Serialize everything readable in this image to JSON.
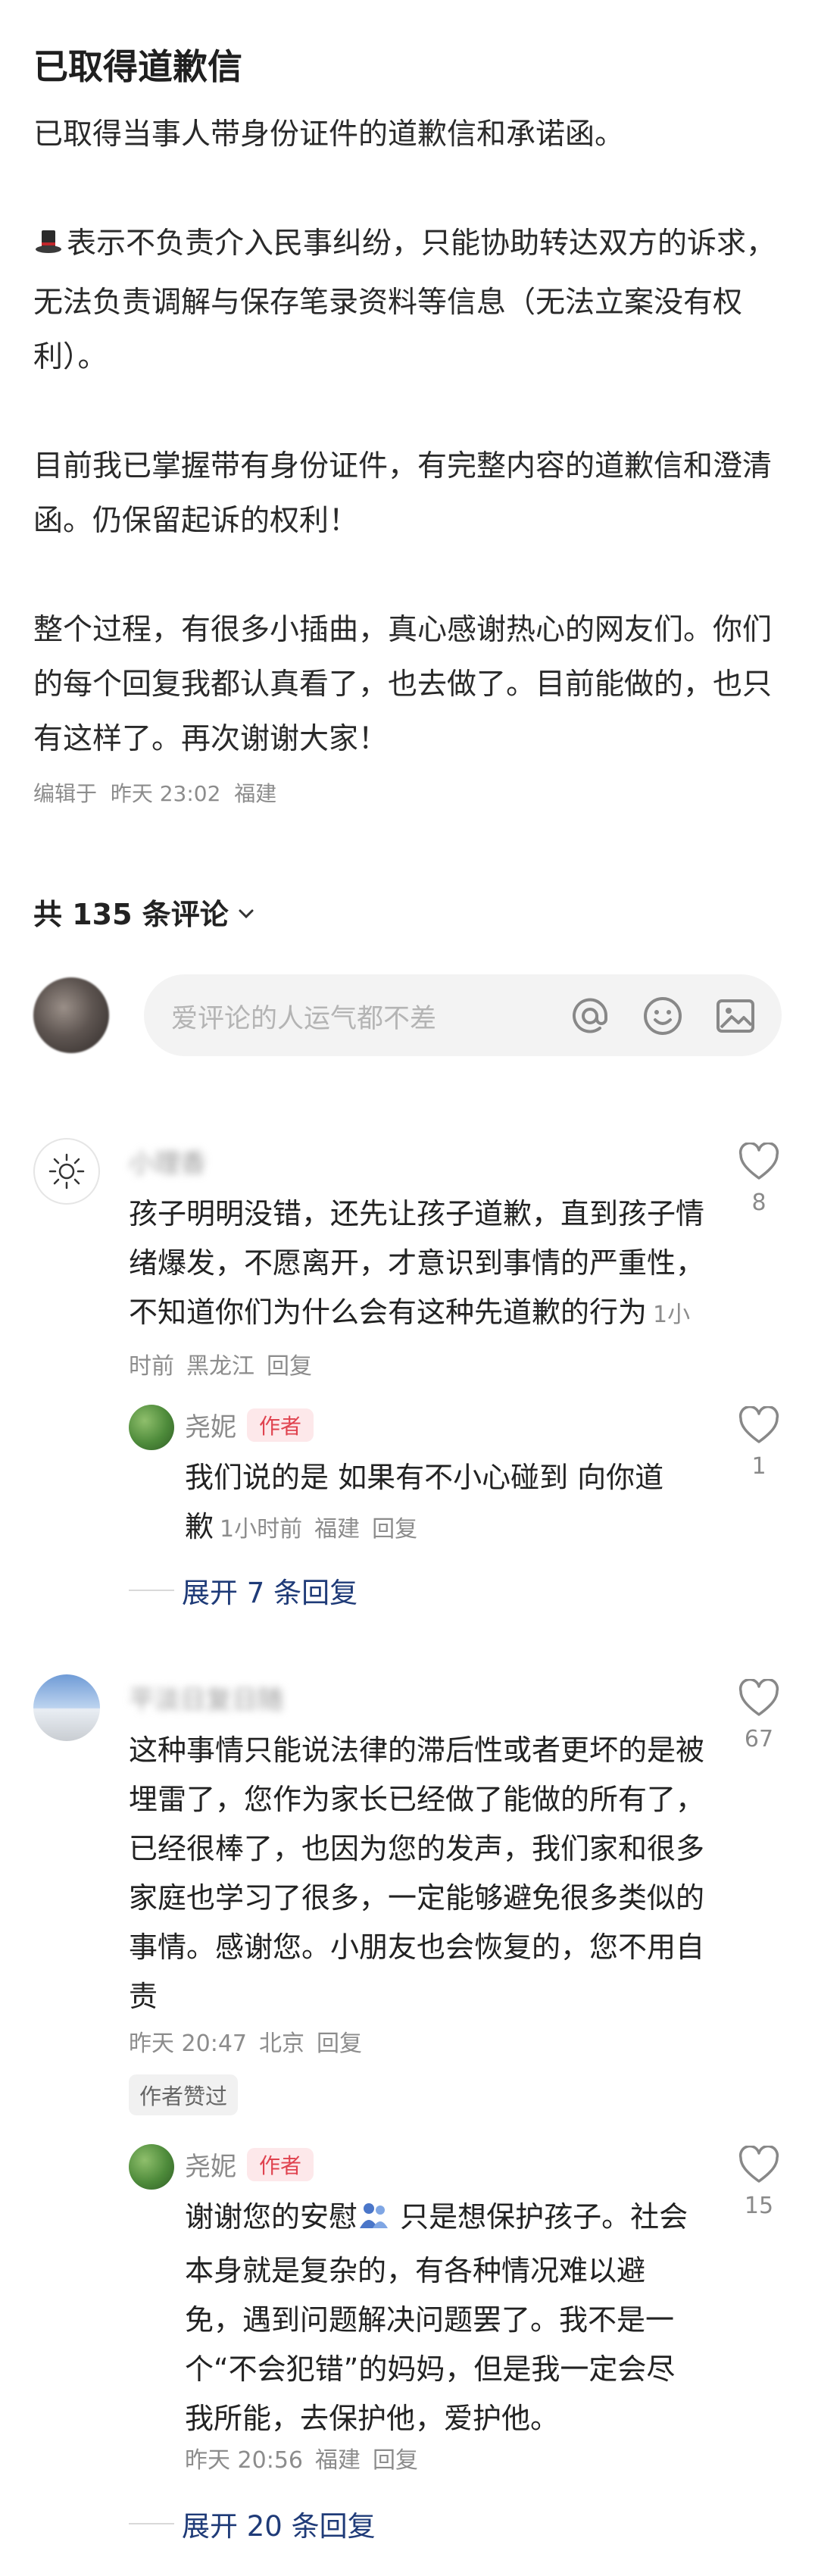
{
  "post": {
    "title": "已取得道歉信",
    "paragraphs": [
      "已取得当事人带身份证件的道歉信和承诺函。",
      "表示不负责介入民事纠纷，只能协助转达双方的诉求，无法负责调解与保存笔录资料等信息（无法立案没有权利）。",
      "目前我已掌握带有身份证件，有完整内容的道歉信和澄清函。仍保留起诉的权利！",
      "整个过程，有很多小插曲，真心感谢热心的网友们。你们的每个回复我都认真看了，也去做了。目前能做的，也只有这样了。再次谢谢大家！"
    ],
    "edited_label": "编辑于",
    "edited_time": "昨天 23:02",
    "edited_location": "福建"
  },
  "comments_header": {
    "count_label": "共 135 条评论"
  },
  "comment_input": {
    "placeholder": "爱评论的人运气都不差"
  },
  "comments": [
    {
      "username": "小理香",
      "text": "孩子明明没错，还先让孩子道歉，直到孩子情绪爆发，不愿离开，才意识到事情的严重性，不知道你们为什么会有这种先道歉的行为",
      "time": "1小时前",
      "location": "黑龙江",
      "reply_label": "回复",
      "likes": "8",
      "reply": {
        "username": "尧妮",
        "tag": "作者",
        "text": "我们说的是 如果有不小心碰到 向你道歉",
        "time": "1小时前",
        "location": "福建",
        "reply_label": "回复",
        "likes": "1"
      },
      "expand_label": "展开 7 条回复"
    },
    {
      "username": "平淡日复日随",
      "text": "这种事情只能说法律的滞后性或者更坏的是被埋雷了，您作为家长已经做了能做的所有了，已经很棒了，也因为您的发声，我们家和很多家庭也学习了很多，一定能够避免很多类似的事情。感谢您。小朋友也会恢复的，您不用自责",
      "time": "昨天 20:47",
      "location": "北京",
      "reply_label": "回复",
      "likes": "67",
      "badge": "作者赞过",
      "reply": {
        "username": "尧妮",
        "tag": "作者",
        "text_before_emoji": "谢谢您的安慰",
        "text_after_emoji": " 只是想保护孩子。社会本身就是复杂的，有各种情况难以避免，遇到问题解决问题罢了。我不是一个“不会犯错”的妈妈，但是我一定会尽我所能，去保护他，爱护他。",
        "time": "昨天 20:56",
        "location": "福建",
        "reply_label": "回复",
        "likes": "15"
      },
      "expand_label": "展开 20 条回复"
    }
  ]
}
